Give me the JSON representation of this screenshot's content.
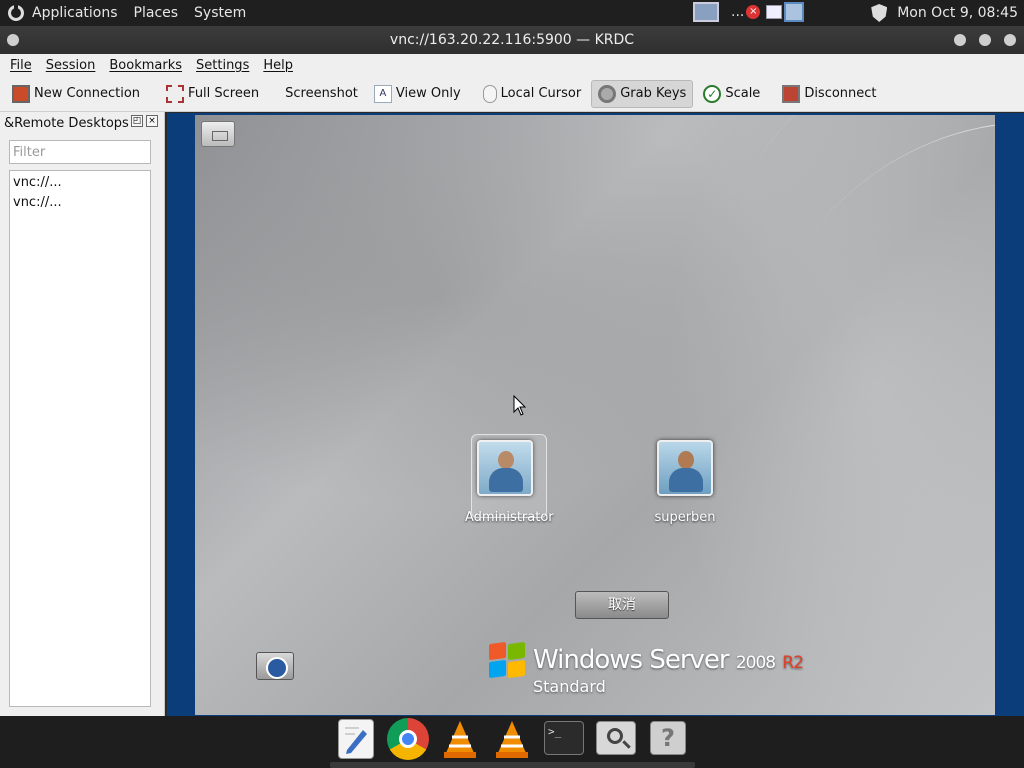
{
  "top_panel": {
    "menus": [
      "Applications",
      "Places",
      "System"
    ],
    "tray_dots": "...",
    "clock": "Mon Oct  9, 08:45"
  },
  "window": {
    "title": "vnc://163.20.22.116:5900 — KRDC"
  },
  "menubar": [
    "File",
    "Session",
    "Bookmarks",
    "Settings",
    "Help"
  ],
  "toolbar": {
    "new_connection": "New Connection",
    "full_screen": "Full Screen",
    "screenshot": "Screenshot",
    "view_only": "View Only",
    "local_cursor": "Local Cursor",
    "grab_keys": "Grab Keys",
    "scale": "Scale",
    "disconnect": "Disconnect"
  },
  "sidepanel": {
    "title": "&Remote Desktops",
    "filter_placeholder": "Filter",
    "items": [
      "vnc://...",
      "vnc://..."
    ]
  },
  "remote_screen": {
    "users": [
      "Administrator",
      "superben"
    ],
    "cancel_label": "取消",
    "brand_name": "Windows Server",
    "brand_version": "2008",
    "brand_release": "R2",
    "brand_edition": "Standard"
  },
  "colors": {
    "remote_border": "#0b3d7a",
    "panel_bg": "#1f1f1f",
    "window_bg": "#efefef"
  }
}
